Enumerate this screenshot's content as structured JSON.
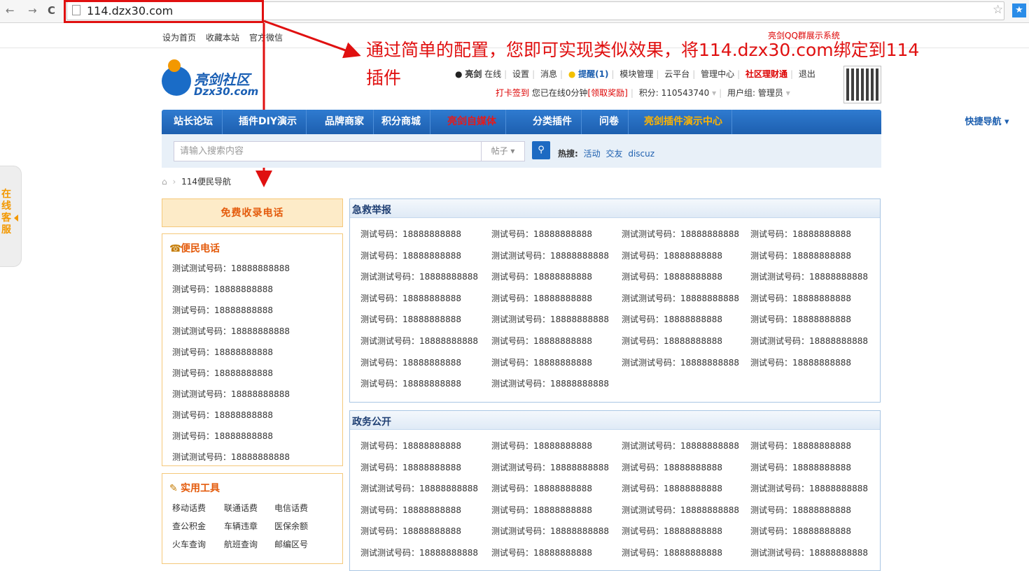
{
  "browser": {
    "back": "←",
    "forward": "→",
    "reload": "C",
    "url": "114.dzx30.com",
    "star": "☆",
    "ext": "★"
  },
  "topbar": {
    "links": [
      "设为首页",
      "收藏本站",
      "官方微信"
    ],
    "qqshow": "亮剑QQ群展示系统"
  },
  "annotation": {
    "line1": "通过简单的配置，您即可实现类似效果，将114.dzx30.com绑定到114",
    "line2": "插件"
  },
  "logo": {
    "cn": "亮剑社区",
    "en": "Dzx30.com"
  },
  "user": {
    "name": "亮剑",
    "status": "在线",
    "links": [
      "设置",
      "消息"
    ],
    "remind": "提醒(1)",
    "links2": [
      "模块管理",
      "云平台",
      "管理中心"
    ],
    "finance": "社区理财通",
    "logout": "退出",
    "checkin": "打卡签到",
    "online": "您已在线0分钟",
    "reward": "[领取奖励]",
    "score": "积分: 110543740",
    "group": "用户组: 管理员"
  },
  "nav": {
    "items": [
      "站长论坛",
      "插件DIY演示",
      "品牌商家",
      "积分商城",
      "亮剑自媒体",
      "分类插件",
      "问卷",
      "亮剑插件演示中心"
    ],
    "quick": "快捷导航"
  },
  "search": {
    "placeholder": "请输入搜索内容",
    "type": "帖子",
    "hot_label": "热搜:",
    "hot": [
      "活动",
      "交友",
      "discuz"
    ]
  },
  "breadcrumb": {
    "current": "114便民导航"
  },
  "sidetab": "在线客服",
  "left": {
    "free_title": "免费收录电话",
    "phone_title": "便民电话",
    "phones": [
      "测试测试号码：18888888888",
      "测试号码：18888888888",
      "测试号码：18888888888",
      "测试测试号码：18888888888",
      "测试号码：18888888888",
      "测试号码：18888888888",
      "测试测试号码：18888888888",
      "测试号码：18888888888",
      "测试号码：18888888888",
      "测试测试号码：18888888888"
    ],
    "tools_title": "实用工具",
    "tools": [
      [
        "移动话费",
        "联通话费",
        "电信话费"
      ],
      [
        "查公积金",
        "车辆违章",
        "医保余额"
      ],
      [
        "火车查询",
        "航班查询",
        "邮编区号"
      ]
    ]
  },
  "panels": [
    {
      "title": "急救举报",
      "rows": [
        [
          "测试号码：18888888888",
          "测试号码：18888888888",
          "测试测试号码：18888888888",
          "测试号码：18888888888"
        ],
        [
          "测试号码：18888888888",
          "测试测试号码：18888888888",
          "测试号码：18888888888",
          "测试号码：18888888888"
        ],
        [
          "测试测试号码：18888888888",
          "测试号码：18888888888",
          "测试号码：18888888888",
          "测试测试号码：18888888888"
        ],
        [
          "测试号码：18888888888",
          "测试号码：18888888888",
          "测试测试号码：18888888888",
          "测试号码：18888888888"
        ],
        [
          "测试号码：18888888888",
          "测试测试号码：18888888888",
          "测试号码：18888888888",
          "测试号码：18888888888"
        ],
        [
          "测试测试号码：18888888888",
          "测试号码：18888888888",
          "测试号码：18888888888",
          "测试测试号码：18888888888"
        ],
        [
          "测试号码：18888888888",
          "测试号码：18888888888",
          "测试测试号码：18888888888",
          "测试号码：18888888888"
        ],
        [
          "测试号码：18888888888",
          "测试测试号码：18888888888"
        ]
      ]
    },
    {
      "title": "政务公开",
      "rows": [
        [
          "测试号码：18888888888",
          "测试号码：18888888888",
          "测试测试号码：18888888888",
          "测试号码：18888888888"
        ],
        [
          "测试号码：18888888888",
          "测试测试号码：18888888888",
          "测试号码：18888888888",
          "测试号码：18888888888"
        ],
        [
          "测试测试号码：18888888888",
          "测试号码：18888888888",
          "测试号码：18888888888",
          "测试测试号码：18888888888"
        ],
        [
          "测试号码：18888888888",
          "测试号码：18888888888",
          "测试测试号码：18888888888",
          "测试号码：18888888888"
        ],
        [
          "测试号码：18888888888",
          "测试测试号码：18888888888",
          "测试号码：18888888888",
          "测试号码：18888888888"
        ],
        [
          "测试测试号码：18888888888",
          "测试号码：18888888888",
          "测试号码：18888888888",
          "测试测试号码：18888888888"
        ]
      ]
    }
  ]
}
